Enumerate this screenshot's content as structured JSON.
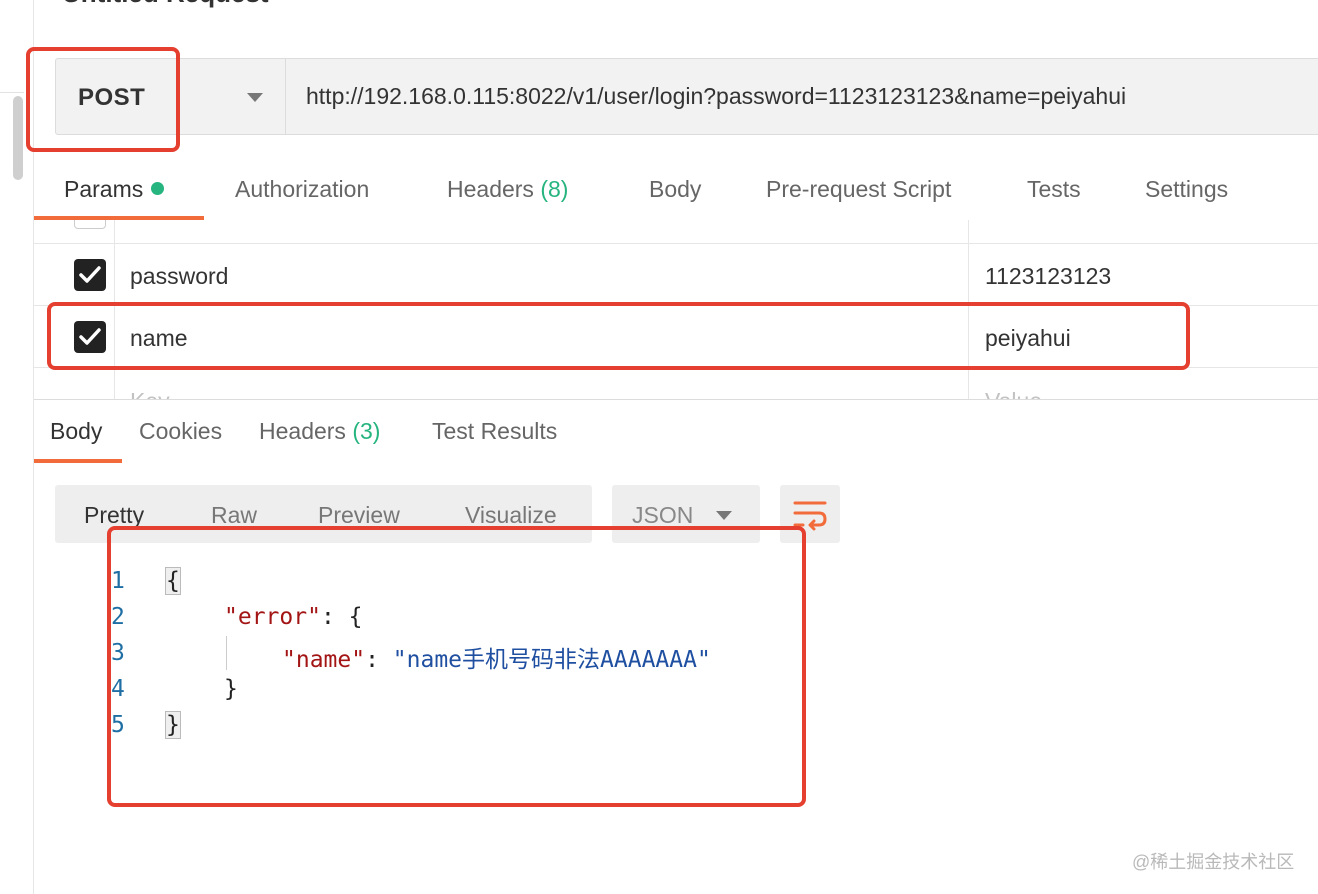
{
  "request": {
    "title": "Untitled Request",
    "method": "POST",
    "url": "http://192.168.0.115:8022/v1/user/login?password=1123123123&name=peiyahui"
  },
  "request_tabs": [
    {
      "label": "Params",
      "active": true
    },
    {
      "label": "Authorization"
    },
    {
      "label": "Headers",
      "count": "(8)"
    },
    {
      "label": "Body"
    },
    {
      "label": "Pre-request Script"
    },
    {
      "label": "Tests"
    },
    {
      "label": "Settings"
    }
  ],
  "params": {
    "rows": [
      {
        "key": "password",
        "value": "1123123123",
        "checked": true
      },
      {
        "key": "name",
        "value": "peiyahui",
        "checked": true
      }
    ],
    "key_placeholder": "Key",
    "value_placeholder": "Value"
  },
  "response_tabs": [
    {
      "label": "Body",
      "active": true
    },
    {
      "label": "Cookies"
    },
    {
      "label": "Headers",
      "count": "(3)"
    },
    {
      "label": "Test Results"
    }
  ],
  "view_modes": [
    "Pretty",
    "Raw",
    "Preview",
    "Visualize"
  ],
  "format": "JSON",
  "code": {
    "line_numbers": [
      "1",
      "2",
      "3",
      "4",
      "5"
    ],
    "open_brace": "{",
    "error_key": "\"error\"",
    "colon_open": ": {",
    "name_key": "\"name\"",
    "colon": ": ",
    "name_value": "\"name手机号码非法AAAAAAA\"",
    "inner_close": "}",
    "close_brace": "}"
  },
  "watermark": "@稀土掘金技术社区",
  "colors": {
    "accent": "#f26b3a",
    "highlight": "#e53f30",
    "green": "#26b47f"
  }
}
